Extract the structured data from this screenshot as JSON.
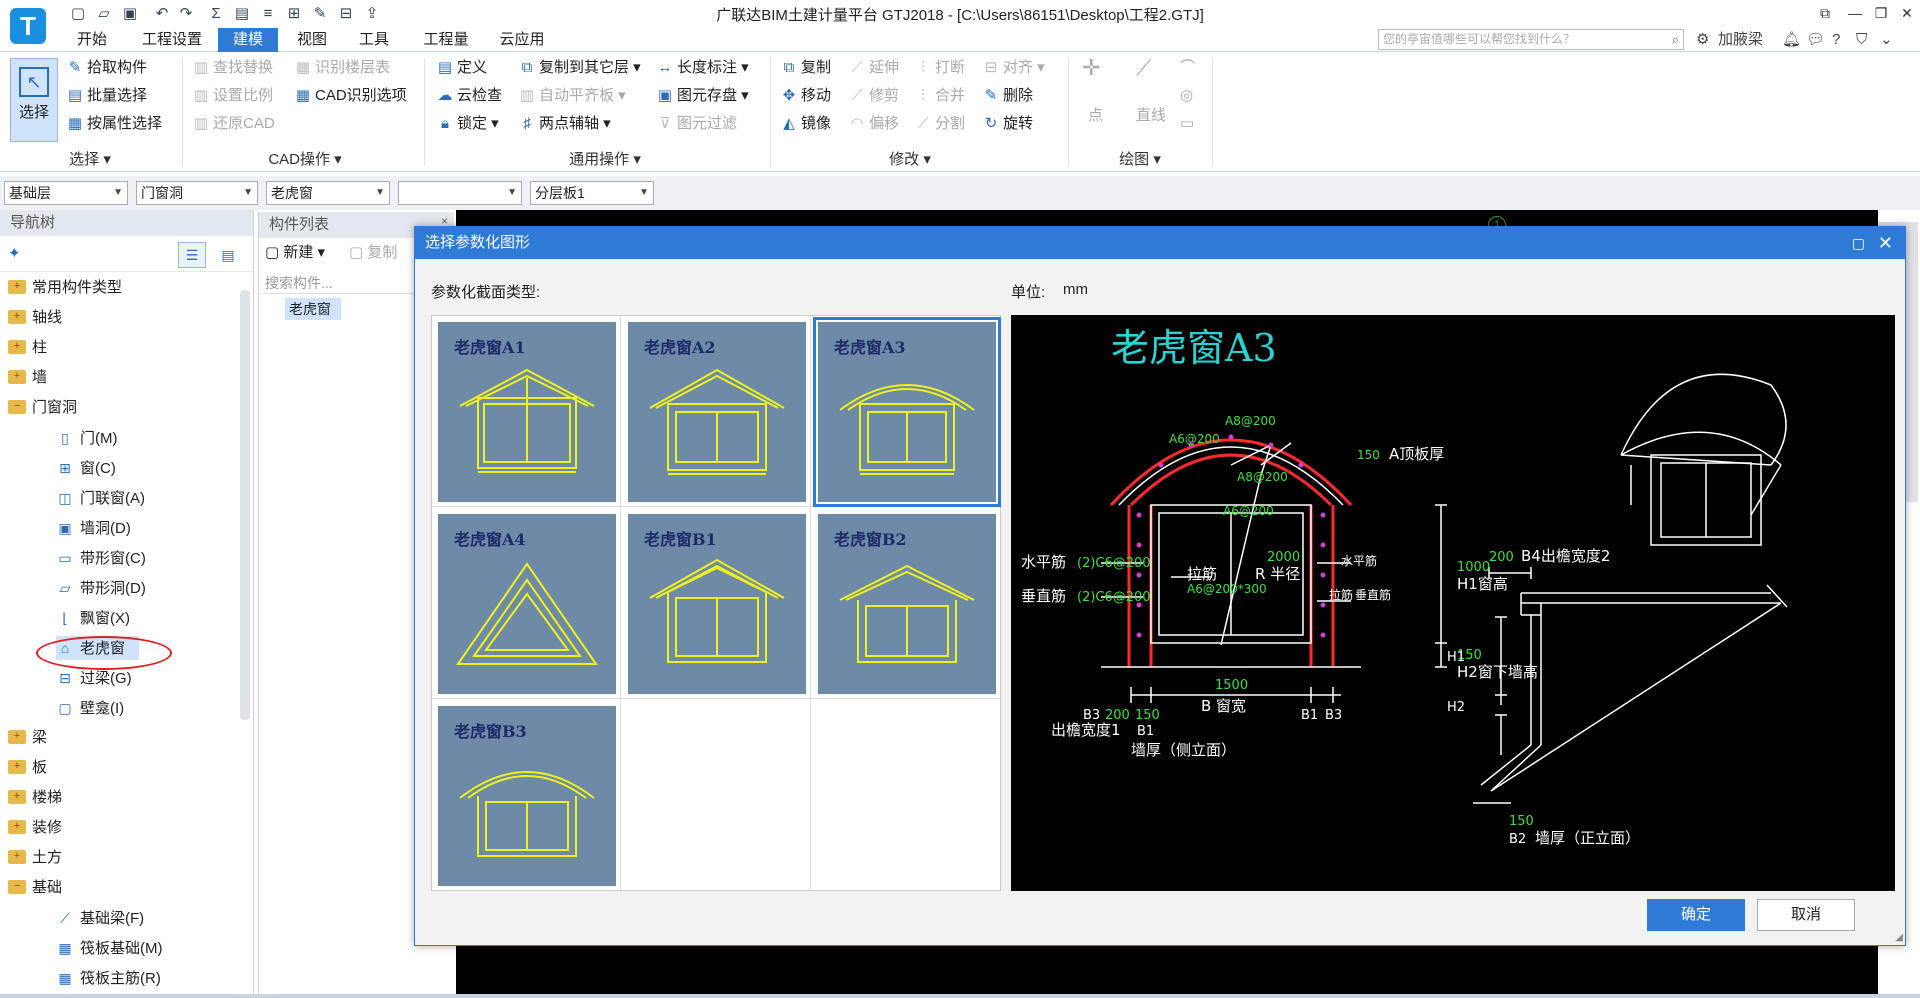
{
  "app": {
    "logo_text": "T",
    "title": "广联达BIM土建计量平台 GTJ2018 - [C:\\Users\\86151\\Desktop\\工程2.GTJ]"
  },
  "menu": {
    "tabs": [
      "开始",
      "工程设置",
      "建模",
      "视图",
      "工具",
      "工程量",
      "云应用"
    ],
    "active": "建模",
    "search_placeholder": "您的亭宙值哪些可以帮您找到什么？",
    "jiajiaoliang": "加腋梁"
  },
  "ribbon": {
    "select": {
      "big_label": "选择",
      "items": [
        "拾取构件",
        "批量选择",
        "按属性选择"
      ],
      "group": "选择"
    },
    "cad": {
      "items": [
        "查找替换",
        "设置比例",
        "还原CAD",
        "识别楼层表",
        "CAD识别选项"
      ],
      "group": "CAD操作"
    },
    "general": {
      "items": [
        "定义",
        "云检查",
        "锁定",
        "复制到其它层",
        "自动平齐板",
        "两点辅轴",
        "长度标注",
        "图元存盘",
        "图元过滤"
      ],
      "group": "通用操作"
    },
    "modify": {
      "items": [
        "复制",
        "移动",
        "镜像",
        "延伸",
        "修剪",
        "偏移",
        "打断",
        "合并",
        "分割",
        "对齐",
        "删除",
        "旋转"
      ],
      "group": "修改"
    },
    "draw": {
      "items": [
        "点",
        "直线"
      ],
      "group": "绘图"
    }
  },
  "filters": [
    "基础层",
    "门窗洞",
    "老虎窗",
    "",
    "分层板1"
  ],
  "nav": {
    "header": "导航树",
    "items": [
      {
        "label": "常用构件类型",
        "type": "folder"
      },
      {
        "label": "轴线",
        "type": "folder"
      },
      {
        "label": "柱",
        "type": "folder"
      },
      {
        "label": "墙",
        "type": "folder"
      },
      {
        "label": "门窗洞",
        "type": "folder-open"
      },
      {
        "label": "门(M)",
        "type": "child",
        "icon": "▯"
      },
      {
        "label": "窗(C)",
        "type": "child",
        "icon": "⊞"
      },
      {
        "label": "门联窗(A)",
        "type": "child",
        "icon": "◫"
      },
      {
        "label": "墙洞(D)",
        "type": "child",
        "icon": "▣"
      },
      {
        "label": "带形窗(C)",
        "type": "child",
        "icon": "▭"
      },
      {
        "label": "带形洞(D)",
        "type": "child",
        "icon": "▱"
      },
      {
        "label": "飘窗(X)",
        "type": "child",
        "icon": "⌊"
      },
      {
        "label": "老虎窗",
        "type": "child-selected",
        "icon": "⌂"
      },
      {
        "label": "过梁(G)",
        "type": "child",
        "icon": "⊟"
      },
      {
        "label": "壁龛(I)",
        "type": "child",
        "icon": "▢"
      },
      {
        "label": "梁",
        "type": "folder"
      },
      {
        "label": "板",
        "type": "folder"
      },
      {
        "label": "楼梯",
        "type": "folder"
      },
      {
        "label": "装修",
        "type": "folder"
      },
      {
        "label": "土方",
        "type": "folder"
      },
      {
        "label": "基础",
        "type": "folder-open"
      },
      {
        "label": "基础梁(F)",
        "type": "child",
        "icon": "⟋"
      },
      {
        "label": "筏板基础(M)",
        "type": "child",
        "icon": "▦"
      },
      {
        "label": "筏板主筋(R)",
        "type": "child",
        "icon": "▦"
      }
    ]
  },
  "components": {
    "header": "构件列表",
    "new_label": "新建",
    "copy_label": "复制",
    "search_placeholder": "搜索构件...",
    "item": "老虎窗"
  },
  "dialog": {
    "title": "选择参数化图形",
    "type_label": "参数化截面类型:",
    "unit_label": "单位:",
    "unit_value": "mm",
    "shapes": [
      "老虎窗A1",
      "老虎窗A2",
      "老虎窗A3",
      "老虎窗A4",
      "老虎窗B1",
      "老虎窗B2",
      "老虎窗B3"
    ],
    "selected": "老虎窗A3",
    "ok": "确定",
    "cancel": "取消"
  },
  "preview": {
    "title": "老虎窗A3",
    "labels": {
      "a8_top": "A8@200",
      "a6_left": "A6@200",
      "a8_inner": "A8@200",
      "a6_inner": "A6@200",
      "thick150": "150",
      "a_roof": "A顶板厚",
      "shuiping": "水平筋",
      "shuiping_val": "(2)C6@200",
      "chuizhi": "垂直筋",
      "chuizhi_val": "(2)C6@200",
      "lajin": "拉筋",
      "lajin_val": "A6@200*300",
      "r2000": "2000",
      "r_label": "R 半径",
      "right_shuiping": "水平筋",
      "right_lajin": "拉筋",
      "right_chuizhi": "垂直筋",
      "h1000": "1000",
      "h1_label": "H1窗高",
      "h150": "150",
      "h2_label": "H2窗下墙高",
      "w1500": "1500",
      "b_label": "B 窗宽",
      "b3_left": "B3",
      "d200": "200",
      "d150": "150",
      "b1_left": "B1",
      "b1_right": "B1",
      "b3_right": "B3",
      "chuyan1": "出檐宽度1",
      "qianghou_side": "墙厚（侧立面）",
      "r200": "200",
      "b4_label": "B4出檐宽度2",
      "h1": "H1",
      "h2": "H2",
      "r150": "150",
      "b2_label": "B2",
      "qianghou_front": "墙厚（正立面）"
    }
  }
}
